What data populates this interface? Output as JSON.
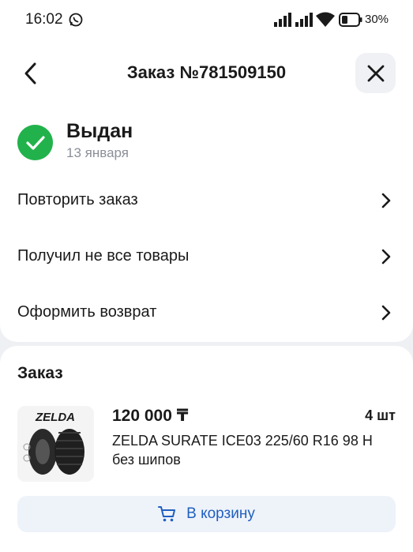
{
  "status_bar": {
    "time": "16:02",
    "battery_percent": "30%"
  },
  "header": {
    "title": "Заказ №781509150",
    "back_icon": "chevron-left-icon",
    "close_icon": "close-icon"
  },
  "order_status": {
    "title": "Выдан",
    "date": "13 января",
    "color": "#22b24c"
  },
  "menu": [
    {
      "label": "Повторить заказ"
    },
    {
      "label": "Получил не все товары"
    },
    {
      "label": "Оформить возврат"
    }
  ],
  "order": {
    "section_title": "Заказ",
    "items": [
      {
        "brand": "ZELDA",
        "price": "120 000 ₸",
        "quantity": "4 шт",
        "name": "ZELDA SURATE ICE03 225/60 R16 98 H без шипов"
      }
    ],
    "cart_button": "В корзину"
  },
  "colors": {
    "accent": "#1f5fbf",
    "success": "#22b24c"
  }
}
